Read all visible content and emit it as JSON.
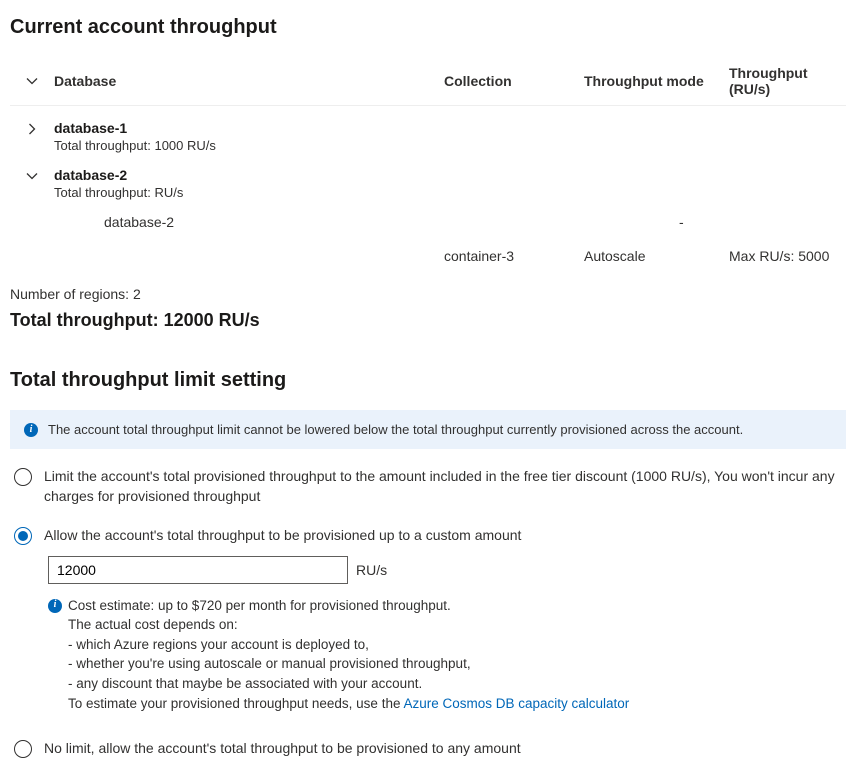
{
  "sections": {
    "current_title": "Current account throughput",
    "limit_title": "Total throughput limit setting"
  },
  "table": {
    "headers": {
      "database": "Database",
      "collection": "Collection",
      "mode": "Throughput mode",
      "throughput": "Throughput (RU/s)"
    }
  },
  "databases": [
    {
      "name": "database-1",
      "sub": "Total throughput: 1000 RU/s"
    },
    {
      "name": "database-2",
      "sub": "Total throughput: RU/s",
      "child_db_label": "database-2",
      "child_db_throughput": "-",
      "container": {
        "name": "container-3",
        "mode": "Autoscale",
        "throughput": "Max RU/s: 5000"
      }
    }
  ],
  "regions_label": "Number of regions: 2",
  "total_throughput": "Total throughput: 12000 RU/s",
  "info_banner": "The account total throughput limit cannot be lowered below the total throughput currently provisioned across the account.",
  "options": {
    "free_tier": "Limit the account's total provisioned throughput to the amount included in the free tier discount (1000 RU/s), You won't incur any charges for provisioned throughput",
    "custom": "Allow the account's total throughput to be provisioned up to a custom amount",
    "no_limit": "No limit, allow the account's total throughput to be provisioned to any amount"
  },
  "custom": {
    "value": "12000",
    "unit": "RU/s"
  },
  "cost": {
    "headline": "Cost estimate: up to $720 per month for provisioned throughput.",
    "depends": "The actual cost depends on:",
    "b1": "- which Azure regions your account is deployed to,",
    "b2": "- whether you're using autoscale or manual provisioned throughput,",
    "b3": "- any discount that maybe be associated with your account.",
    "estimate_prefix": "To estimate your provisioned throughput needs, use the ",
    "link_text": "Azure Cosmos DB capacity calculator"
  }
}
